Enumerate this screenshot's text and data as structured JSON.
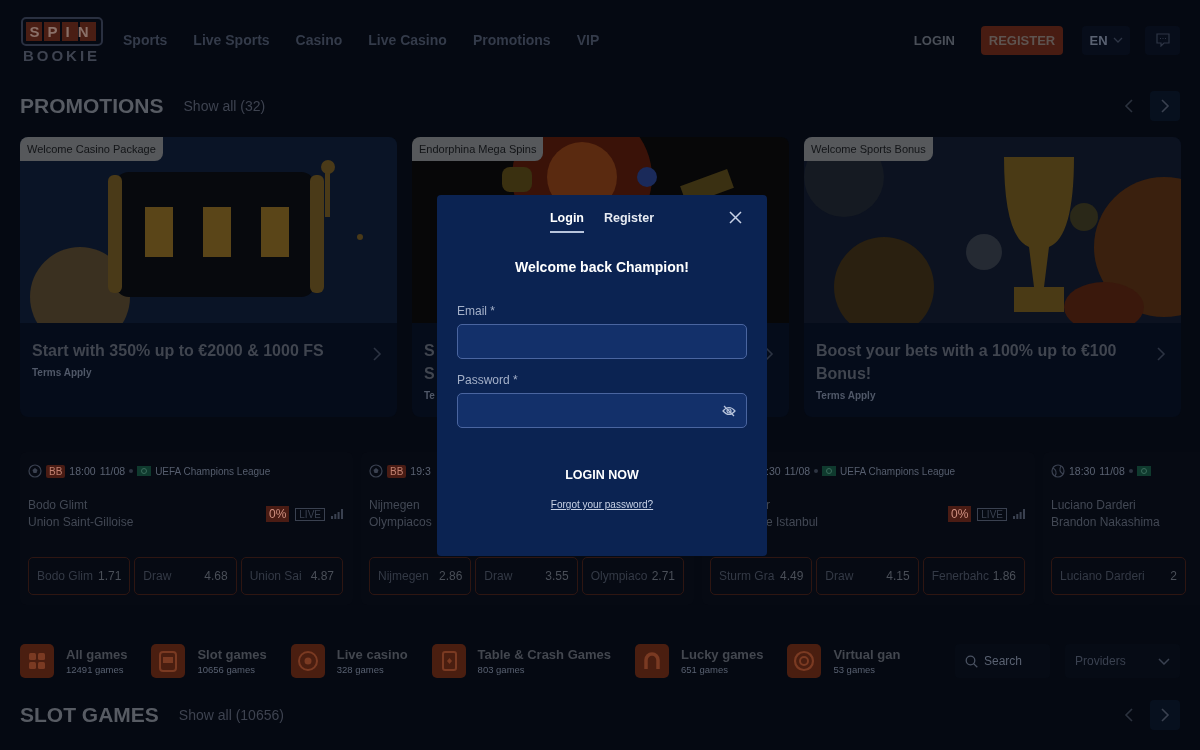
{
  "header": {
    "logo_top": "SPIN",
    "logo_bottom": "BOOKIE",
    "nav": [
      "Sports",
      "Live Sports",
      "Casino",
      "Live Casino",
      "Promotions",
      "VIP"
    ],
    "login": "LOGIN",
    "register": "REGISTER",
    "language": "EN"
  },
  "promotions": {
    "title": "PROMOTIONS",
    "show_all": "Show all (32)",
    "cards": [
      {
        "tag": "Welcome Casino Package",
        "title": "Start with 350% up to €2000 & 1000 FS",
        "terms": "Terms Apply"
      },
      {
        "tag": "Endorphina Mega Spins",
        "title": "S\nS",
        "terms": "Te"
      },
      {
        "tag": "Welcome Sports Bonus",
        "title": "Boost your bets with a 100% up to €100 Bonus!",
        "terms": "Terms Apply"
      }
    ]
  },
  "matches": [
    {
      "kind": "football",
      "badge": "BB",
      "time": "18:00",
      "date": "11/08",
      "flag": true,
      "league": "UEFA Champions League",
      "covered": false,
      "teams": [
        "Bodo Glimt",
        "Union Saint-Gilloise"
      ],
      "boost": "0%",
      "live": "LIVE",
      "odds": [
        {
          "label": "Bodo Glim",
          "value": "1.71"
        },
        {
          "label": "Draw",
          "value": "4.68"
        },
        {
          "label": "Union Sai",
          "value": "4.87"
        }
      ]
    },
    {
      "kind": "football",
      "badge": "BB",
      "time": "19:3",
      "flag": false,
      "covered": false,
      "teams": [
        "Nijmegen",
        "Olympiacos"
      ],
      "odds": [
        {
          "label": "Nijmegen",
          "value": "2.86"
        },
        {
          "label": "Draw",
          "value": "3.55"
        },
        {
          "label": "Olympiaco",
          "value": "2.71"
        }
      ]
    },
    {
      "time": ":30",
      "date": "11/08",
      "flag": true,
      "league": "UEFA Champions League",
      "covered": true,
      "teams": [
        "r",
        "e Istanbul"
      ],
      "boost": "0%",
      "live": "LIVE",
      "odds": [
        {
          "label": "Sturm Gra",
          "value": "4.49"
        },
        {
          "label": "Draw",
          "value": "4.15"
        },
        {
          "label": "Fenerbahc",
          "value": "1.86"
        }
      ]
    },
    {
      "kind": "tennis",
      "time": "18:30",
      "date": "11/08",
      "flag": true,
      "covered": false,
      "teams": [
        "Luciano Darderi",
        "Brandon Nakashima"
      ],
      "odds": [
        {
          "label": "Luciano Darderi",
          "value": "2"
        }
      ]
    }
  ],
  "categories": {
    "items": [
      {
        "kind": "all",
        "name": "All games",
        "count": "12491 games"
      },
      {
        "kind": "slot",
        "name": "Slot games",
        "count": "10656 games"
      },
      {
        "kind": "live",
        "name": "Live casino",
        "count": "328 games"
      },
      {
        "kind": "table",
        "name": "Table & Crash Games",
        "count": "803 games"
      },
      {
        "kind": "lucky",
        "name": "Lucky games",
        "count": "651 games"
      },
      {
        "kind": "virtual",
        "name": "Virtual gan",
        "count": "53 games"
      }
    ],
    "search_placeholder": "Search",
    "providers": "Providers"
  },
  "slot_games": {
    "title": "SLOT GAMES",
    "show_all": "Show all (10656)"
  },
  "modal": {
    "tabs": [
      {
        "label": "Login",
        "selected": true
      },
      {
        "label": "Register",
        "selected": false
      }
    ],
    "heading": "Welcome back Champion!",
    "fields": [
      {
        "label": "Email *",
        "kind": "email"
      },
      {
        "label": "Password *",
        "kind": "password"
      }
    ],
    "submit": "LOGIN NOW",
    "forgot": "Forgot your password?"
  }
}
